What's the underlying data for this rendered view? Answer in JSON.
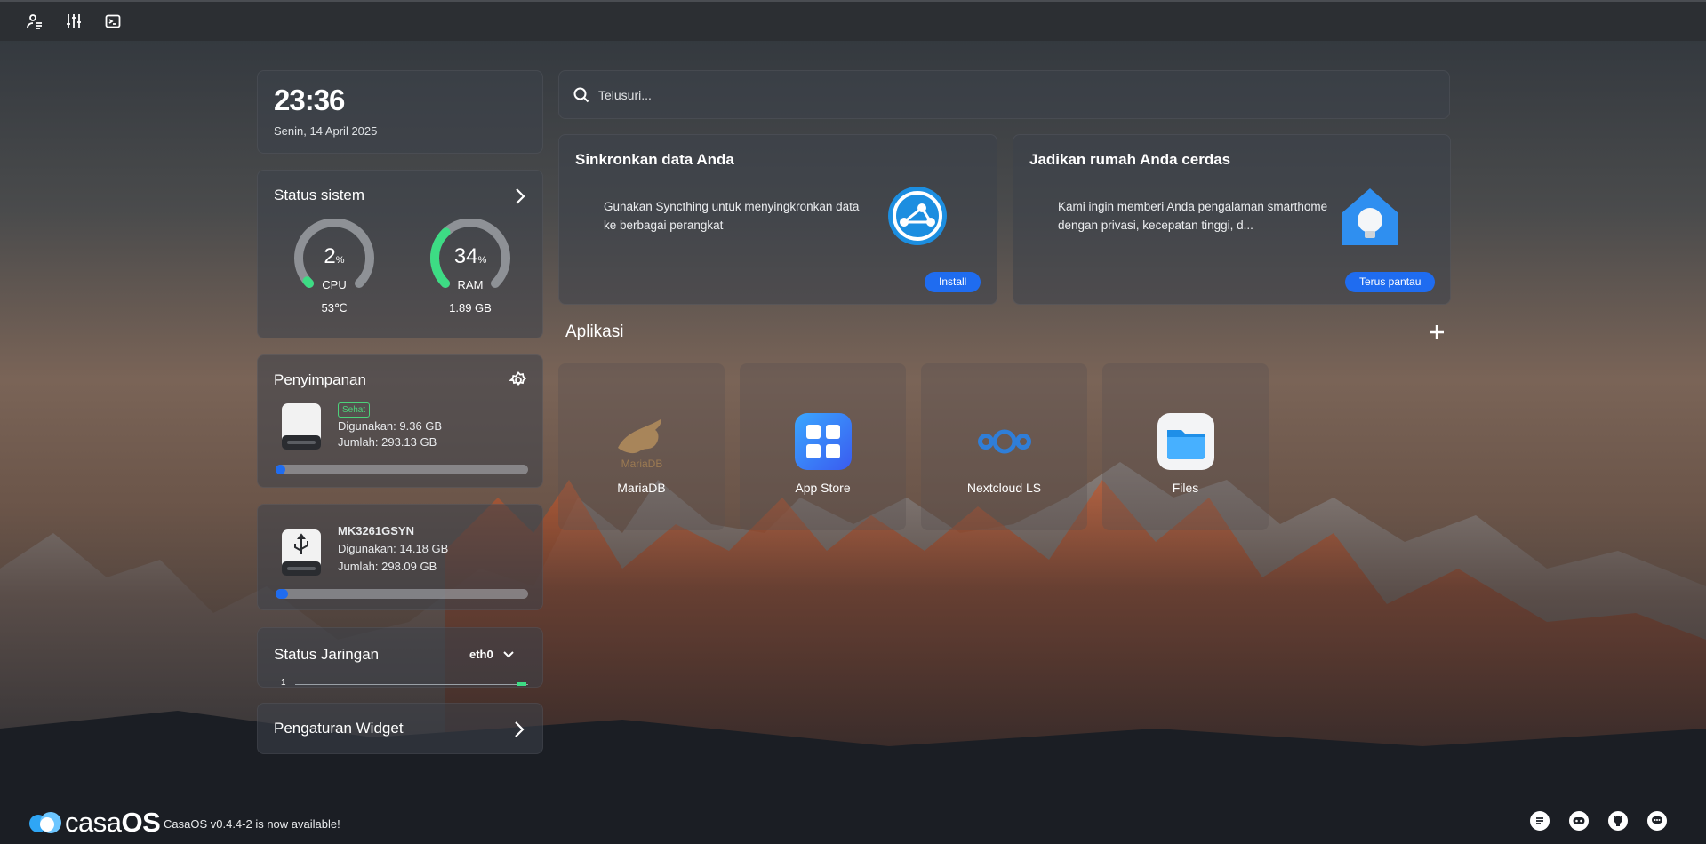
{
  "clock": {
    "time": "23:36",
    "date": "Senin, 14 April 2025"
  },
  "system_status": {
    "title": "Status sistem",
    "cpu": {
      "value": "2",
      "unit": "%",
      "label": "CPU",
      "sub": "53℃",
      "percent": 2
    },
    "ram": {
      "value": "34",
      "unit": "%",
      "label": "RAM",
      "sub": "1.89 GB",
      "percent": 34
    }
  },
  "storage": {
    "title": "Penyimpanan",
    "disk1": {
      "badge": "Sehat",
      "used": "Digunakan: 9.36 GB",
      "total": "Jumlah: 293.13 GB",
      "used_fraction": 0.032
    },
    "disk2": {
      "name": "MK3261GSYN",
      "used": "Digunakan: 14.18 GB",
      "total": "Jumlah: 298.09 GB",
      "used_fraction": 0.048
    }
  },
  "network": {
    "title": "Status Jaringan",
    "interface": "eth0",
    "scale": "1"
  },
  "widget_settings": {
    "title": "Pengaturan Widget"
  },
  "search": {
    "placeholder": "Telusuri..."
  },
  "promos": [
    {
      "title": "Sinkronkan data Anda",
      "desc": "Gunakan Syncthing untuk menyingkronkan data ke berbagai perangkat",
      "button": "Install"
    },
    {
      "title": "Jadikan rumah Anda cerdas",
      "desc": "Kami ingin memberi Anda pengalaman smarthome dengan privasi, kecepatan tinggi, d...",
      "button": "Terus pantau"
    }
  ],
  "apps": {
    "title": "Aplikasi",
    "items": [
      {
        "name": "MariaDB",
        "icon": "mariadb-icon",
        "logo_text": "MariaDB"
      },
      {
        "name": "App Store",
        "icon": "app-store-icon"
      },
      {
        "name": "Nextcloud LS",
        "icon": "nextcloud-icon"
      },
      {
        "name": "Files",
        "icon": "files-icon"
      }
    ]
  },
  "footer": {
    "brand_a": "casa",
    "brand_b": "OS",
    "note": "CasaOS v0.4.4-2 is now available!"
  },
  "colors": {
    "accent": "#1f6cf0",
    "gauge_fill": "#3ddc84",
    "healthy": "#4cd27a"
  }
}
